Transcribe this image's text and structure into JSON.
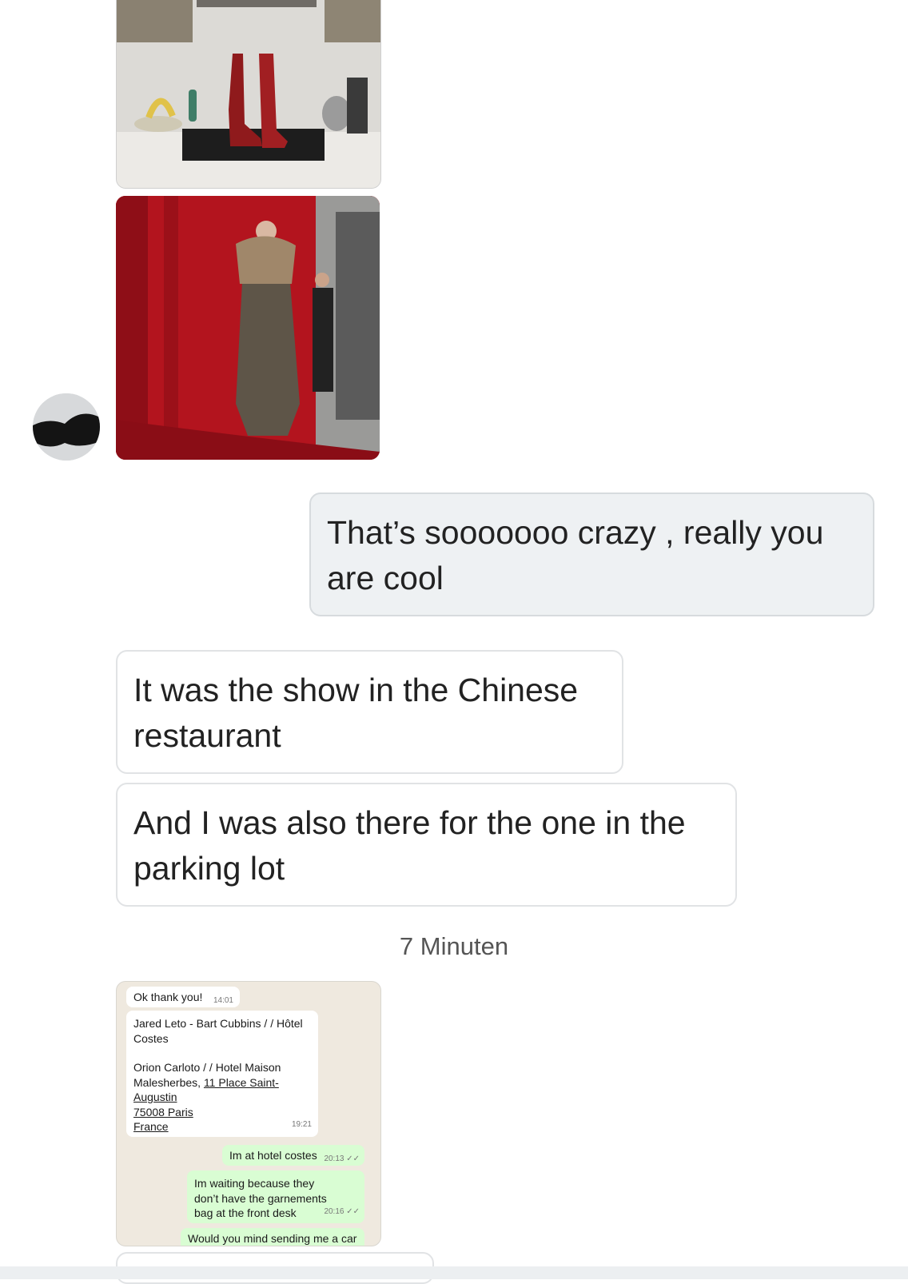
{
  "conversation": {
    "media": [
      {
        "kind": "photo",
        "subject": "red cowboy boots on kitchen counter"
      },
      {
        "kind": "photo",
        "subject": "model in fur coat before red curtain"
      }
    ],
    "messages": [
      {
        "direction": "outgoing",
        "text": "That’s sooooooo crazy , really you are cool"
      },
      {
        "direction": "incoming",
        "text": "It was the show in the Chinese restaurant"
      },
      {
        "direction": "incoming",
        "text": "And I was also there for the one in the parking lot"
      }
    ],
    "time_divider": "7 Minuten",
    "attachment_screenshot": {
      "msg1_text": "Ok thank you!",
      "msg1_time": "14:01",
      "msg2_line1": "Jared Leto - Bart Cubbins / / Hôtel Costes",
      "msg2_line2a": "Orion Carloto / / Hotel Maison Malesherbes,",
      "msg2_link": "11 Place Saint-Augustin",
      "msg2_link2": "75008 Paris",
      "msg2_link3": "France",
      "msg2_time": "19:21",
      "msg3_text": "Im at hotel costes",
      "msg3_time": "20:13 ✓✓",
      "msg4_text": "Im waiting because they don’t have the garnements bag at the front desk",
      "msg4_time": "20:16 ✓✓",
      "msg5_text": "Would you mind sending me a car"
    }
  },
  "colors": {
    "outgoing_bubble": "#eef1f3",
    "incoming_bubble": "#ffffff",
    "wa_outgoing": "#d9fdd3",
    "wa_background": "#efe9df"
  }
}
